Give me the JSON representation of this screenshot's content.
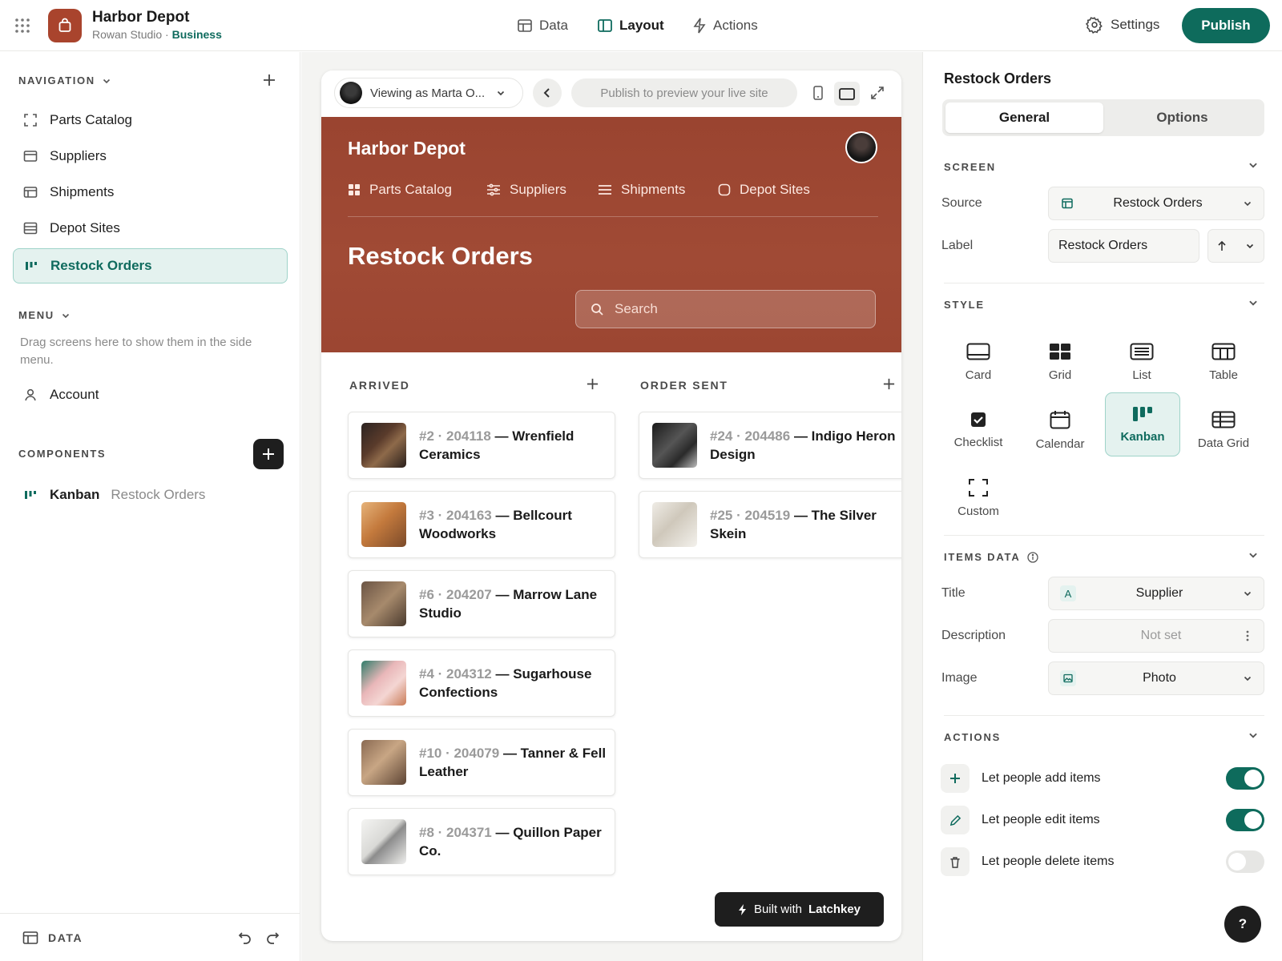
{
  "app": {
    "name": "Harbor Depot",
    "workspace": "Rowan Studio",
    "plan": "Business"
  },
  "top_tabs": [
    {
      "label": "Data"
    },
    {
      "label": "Layout"
    },
    {
      "label": "Actions"
    }
  ],
  "settings_label": "Settings",
  "publish_label": "Publish",
  "sidebar": {
    "navigation_title": "NAVIGATION",
    "nav_items": [
      {
        "label": "Parts Catalog",
        "icon": "expand-icon"
      },
      {
        "label": "Suppliers",
        "icon": "window-icon"
      },
      {
        "label": "Shipments",
        "icon": "table-icon"
      },
      {
        "label": "Depot Sites",
        "icon": "list-icon"
      },
      {
        "label": "Restock Orders",
        "icon": "kanban-icon",
        "active": true
      }
    ],
    "menu_title": "MENU",
    "menu_hint": "Drag screens here to show them in the side menu.",
    "account_label": "Account",
    "components_title": "COMPONENTS",
    "component": {
      "type": "Kanban",
      "name": "Restock Orders"
    },
    "bottom_label": "DATA"
  },
  "preview": {
    "viewing_as": "Viewing as Marta O...",
    "publish_hint": "Publish to preview your live site",
    "site_name": "Harbor Depot",
    "site_nav": [
      "Parts Catalog",
      "Suppliers",
      "Shipments",
      "Depot Sites"
    ],
    "screen_title": "Restock Orders",
    "search_placeholder": "Search",
    "columns": [
      {
        "title": "ARRIVED",
        "cards": [
          {
            "num": "#2 · 204118",
            "name": "— Wrenfield Ceramics"
          },
          {
            "num": "#3 · 204163",
            "name": "— Bellcourt Woodworks"
          },
          {
            "num": "#6 · 204207",
            "name": "— Marrow Lane Studio"
          },
          {
            "num": "#4 · 204312",
            "name": "— Sugarhouse Confections"
          },
          {
            "num": "#10 · 204079",
            "name": "— Tanner & Fell Leather"
          },
          {
            "num": "#8 · 204371",
            "name": "— Quillon Paper Co."
          }
        ]
      },
      {
        "title": "ORDER SENT",
        "cards": [
          {
            "num": "#24 · 204486",
            "name": "— Indigo Heron Design"
          },
          {
            "num": "#25 · 204519",
            "name": "— The Silver Skein"
          }
        ]
      }
    ],
    "built_with": "Built with",
    "built_brand": "Latchkey"
  },
  "panel": {
    "title": "Restock Orders",
    "tabs": [
      "General",
      "Options"
    ],
    "screen_title": "SCREEN",
    "source_label": "Source",
    "source_value": "Restock Orders",
    "label_label": "Label",
    "label_value": "Restock Orders",
    "style_title": "STYLE",
    "styles": [
      "Card",
      "Grid",
      "List",
      "Table",
      "Checklist",
      "Calendar",
      "Kanban",
      "Data Grid",
      "Custom"
    ],
    "selected_style": "Kanban",
    "items_title": "ITEMS DATA",
    "title_label": "Title",
    "title_value": "Supplier",
    "title_badge": "A",
    "desc_label": "Description",
    "desc_value": "Not set",
    "image_label": "Image",
    "image_value": "Photo",
    "actions_title": "ACTIONS",
    "actions": [
      {
        "label": "Let people add items",
        "enabled": true
      },
      {
        "label": "Let people edit items",
        "enabled": true
      },
      {
        "label": "Let people delete items",
        "enabled": false
      }
    ],
    "help": "?"
  },
  "colors": {
    "brand": "#a9442d",
    "accent": "#0e6b5c",
    "hero": "#9e4732"
  }
}
